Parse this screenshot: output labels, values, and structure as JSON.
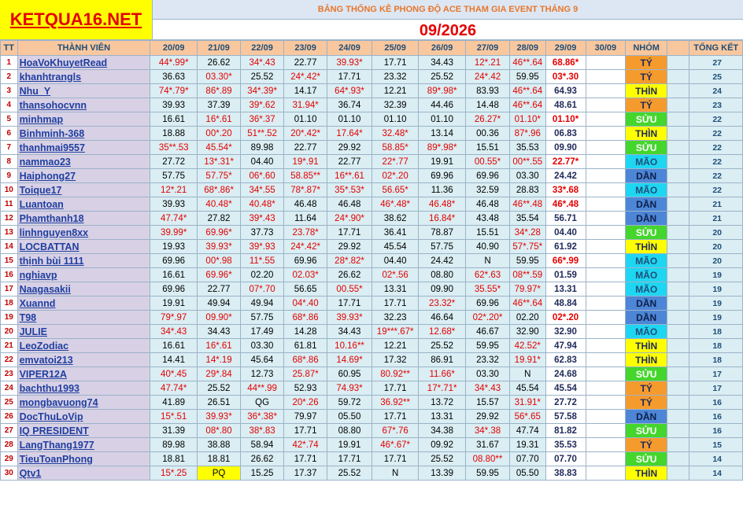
{
  "logo": "KETQUA16.NET",
  "title": "BẢNG THỐNG KÊ PHONG ĐỘ ACE THAM GIA EVENT THÁNG 9",
  "month": "09/2026",
  "headers": {
    "tt": "TT",
    "member": "THÀNH VIÊN",
    "dates": [
      "20/09",
      "21/09",
      "22/09",
      "23/09",
      "24/09",
      "25/09",
      "26/09",
      "27/09",
      "28/09",
      "29/09",
      "30/09"
    ],
    "group": "NHÓM",
    "total": "TỔNG KẾT"
  },
  "colors": {
    "TÝ": "#f59b2d",
    "THÌN": "#ffff00",
    "SỬU": "#44d62c",
    "MÃO": "#1fd6f2",
    "DẦN": "#4d86d6"
  },
  "rows": [
    {
      "tt": "1",
      "name": "HoaVoKhuyetRead",
      "vals": [
        "44*.99*",
        "26.62",
        "34*.43",
        "22.77",
        "39.93*",
        "17.71",
        "34.43",
        "12*.21",
        "46**.64",
        "68.86*",
        ""
      ],
      "group": "TÝ",
      "total": "27"
    },
    {
      "tt": "2",
      "name": "khanhtrangls",
      "vals": [
        "36.63",
        "03.30*",
        "25.52",
        "24*.42*",
        "17.71",
        "23.32",
        "25.52",
        "24*.42",
        "59.95",
        "03*.30",
        ""
      ],
      "group": "TÝ",
      "total": "25"
    },
    {
      "tt": "3",
      "name": "Nhu_Y",
      "vals": [
        "74*.79*",
        "86*.89",
        "34*.39*",
        "14.17",
        "64*.93*",
        "12.21",
        "89*.98*",
        "83.93",
        "46**.64",
        "64.93",
        ""
      ],
      "group": "THÌN",
      "total": "24"
    },
    {
      "tt": "4",
      "name": "thansohocvnn",
      "vals": [
        "39.93",
        "37.39",
        "39*.62",
        "31.94*",
        "36.74",
        "32.39",
        "44.46",
        "14.48",
        "46**.64",
        "48.61",
        ""
      ],
      "group": "TÝ",
      "total": "23"
    },
    {
      "tt": "5",
      "name": "minhmap",
      "vals": [
        "16.61",
        "16*.61",
        "36*.37",
        "01.10",
        "01.10",
        "01.10",
        "01.10",
        "26.27*",
        "01.10*",
        "01.10*",
        ""
      ],
      "group": "SỬU",
      "total": "22"
    },
    {
      "tt": "6",
      "name": "Binhminh-368",
      "vals": [
        "18.88",
        "00*.20",
        "51**.52",
        "20*.42*",
        "17.64*",
        "32.48*",
        "13.14",
        "00.36",
        "87*.96",
        "06.83",
        ""
      ],
      "group": "THÌN",
      "total": "22"
    },
    {
      "tt": "7",
      "name": "thanhmai9557",
      "vals": [
        "35**.53",
        "45.54*",
        "89.98",
        "22.77",
        "29.92",
        "58.85*",
        "89*.98*",
        "15.51",
        "35.53",
        "09.90",
        ""
      ],
      "group": "SỬU",
      "total": "22"
    },
    {
      "tt": "8",
      "name": "nammao23",
      "vals": [
        "27.72",
        "13*.31*",
        "04.40",
        "19*.91",
        "22.77",
        "22*.77",
        "19.91",
        "00.55*",
        "00**.55",
        "22.77*",
        ""
      ],
      "group": "MÃO",
      "total": "22"
    },
    {
      "tt": "9",
      "name": "Haiphong27",
      "vals": [
        "57.75",
        "57.75*",
        "06*.60",
        "58.85**",
        "16**.61",
        "02*.20",
        "69.96",
        "69.96",
        "03.30",
        "24.42",
        ""
      ],
      "group": "DẦN",
      "total": "22"
    },
    {
      "tt": "10",
      "name": "Toique17",
      "vals": [
        "12*.21",
        "68*.86*",
        "34*.55",
        "78*.87*",
        "35*.53*",
        "56.65*",
        "11.36",
        "32.59",
        "28.83",
        "33*.68",
        ""
      ],
      "group": "MÃO",
      "total": "22"
    },
    {
      "tt": "11",
      "name": "Luantoan",
      "vals": [
        "39.93",
        "40.48*",
        "40.48*",
        "46.48",
        "46.48",
        "46*.48*",
        "46.48*",
        "46.48",
        "46**.48",
        "46*.48",
        ""
      ],
      "group": "DẦN",
      "total": "21"
    },
    {
      "tt": "12",
      "name": "Phamthanh18",
      "vals": [
        "47.74*",
        "27.82",
        "39*.43",
        "11.64",
        "24*.90*",
        "38.62",
        "16.84*",
        "43.48",
        "35.54",
        "56.71",
        ""
      ],
      "group": "DẦN",
      "total": "21"
    },
    {
      "tt": "13",
      "name": "linhnguyen8xx",
      "vals": [
        "39.99*",
        "69.96*",
        "37.73",
        "23.78*",
        "17.71",
        "36.41",
        "78.87",
        "15.51",
        "34*.28",
        "04.40",
        ""
      ],
      "group": "SỬU",
      "total": "20"
    },
    {
      "tt": "14",
      "name": "LOCBATTAN",
      "vals": [
        "19.93",
        "39.93*",
        "39*.93",
        "24*.42*",
        "29.92",
        "45.54",
        "57.75",
        "40.90",
        "57*.75*",
        "61.92",
        ""
      ],
      "group": "THÌN",
      "total": "20"
    },
    {
      "tt": "15",
      "name": "thịnh bùi 1111",
      "vals": [
        "69.96",
        "00*.98",
        "11*.55",
        "69.96",
        "28*.82*",
        "04.40",
        "24.42",
        "N",
        "59.95",
        "66*.99",
        ""
      ],
      "group": "MÃO",
      "total": "20"
    },
    {
      "tt": "16",
      "name": "nghiavp",
      "vals": [
        "16.61",
        "69.96*",
        "02.20",
        "02.03*",
        "26.62",
        "02*.56",
        "08.80",
        "62*.63",
        "08**.59",
        "01.59",
        ""
      ],
      "group": "MÃO",
      "total": "19"
    },
    {
      "tt": "17",
      "name": "Naagasakii",
      "vals": [
        "69.96",
        "22.77",
        "07*.70",
        "56.65",
        "00.55*",
        "13.31",
        "09.90",
        "35.55*",
        "79.97*",
        "13.31",
        ""
      ],
      "group": "MÃO",
      "total": "19"
    },
    {
      "tt": "18",
      "name": "Xuannd",
      "vals": [
        "19.91",
        "49.94",
        "49.94",
        "04*.40",
        "17.71",
        "17.71",
        "23.32*",
        "69.96",
        "46**.64",
        "48.84",
        ""
      ],
      "group": "DẦN",
      "total": "19"
    },
    {
      "tt": "19",
      "name": "T98",
      "vals": [
        "79*.97",
        "09.90*",
        "57.75",
        "68*.86",
        "39.93*",
        "32.23",
        "46.64",
        "02*.20*",
        "02.20",
        "02*.20",
        ""
      ],
      "group": "DẦN",
      "total": "19"
    },
    {
      "tt": "20",
      "name": "JULIE",
      "vals": [
        "34*.43",
        "34.43",
        "17.49",
        "14.28",
        "34.43",
        "19***.67*",
        "12.68*",
        "46.67",
        "32.90",
        "32.90",
        ""
      ],
      "group": "MÃO",
      "total": "18"
    },
    {
      "tt": "21",
      "name": "LeoZodiac",
      "vals": [
        "16.61",
        "16*.61",
        "03.30",
        "61.81",
        "10.16**",
        "12.21",
        "25.52",
        "59.95",
        "42.52*",
        "47.94",
        ""
      ],
      "group": "THÌN",
      "total": "18"
    },
    {
      "tt": "22",
      "name": "emvatoi213",
      "vals": [
        "14.41",
        "14*.19",
        "45.64",
        "68*.86",
        "14.69*",
        "17.32",
        "86.91",
        "23.32",
        "19.91*",
        "62.83",
        ""
      ],
      "group": "THÌN",
      "total": "18"
    },
    {
      "tt": "23",
      "name": "VIPER12A",
      "vals": [
        "40*.45",
        "29*.84",
        "12.73",
        "25.87*",
        "60.95",
        "80.92**",
        "11.66*",
        "03.30",
        "N",
        "24.68",
        ""
      ],
      "group": "SỬU",
      "total": "17"
    },
    {
      "tt": "24",
      "name": "bachthu1993",
      "vals": [
        "47.74*",
        "25.52",
        "44**.99",
        "52.93",
        "74.93*",
        "17.71",
        "17*.71*",
        "34*.43",
        "45.54",
        "45.54",
        ""
      ],
      "group": "TÝ",
      "total": "17"
    },
    {
      "tt": "25",
      "name": "mongbavuong74",
      "vals": [
        "41.89",
        "26.51",
        "QG",
        "20*.26",
        "59.72",
        "36.92**",
        "13.72",
        "15.57",
        "31.91*",
        "27.72",
        ""
      ],
      "group": "TÝ",
      "total": "16"
    },
    {
      "tt": "26",
      "name": "DocThuLoVip",
      "vals": [
        "15*.51",
        "39.93*",
        "36*.38*",
        "79.97",
        "05.50",
        "17.71",
        "13.31",
        "29.92",
        "56*.65",
        "57.58",
        ""
      ],
      "group": "DẦN",
      "total": "16"
    },
    {
      "tt": "27",
      "name": "IQ PRESIDENT",
      "vals": [
        "31.39",
        "08*.80",
        "38*.83",
        "17.71",
        "08.80",
        "67*.76",
        "34.38",
        "34*.38",
        "47.74",
        "81.82",
        ""
      ],
      "group": "SỬU",
      "total": "16"
    },
    {
      "tt": "28",
      "name": "LangThang1977",
      "vals": [
        "89.98",
        "38.88",
        "58.94",
        "42*.74",
        "19.91",
        "46*.67*",
        "09.92",
        "31.67",
        "19.31",
        "35.53",
        ""
      ],
      "group": "TÝ",
      "total": "15"
    },
    {
      "tt": "29",
      "name": "TieuToanPhong",
      "vals": [
        "18.81",
        "18.81",
        "26.62",
        "17.71",
        "17.71",
        "17.71",
        "25.52",
        "08.80**",
        "07.70",
        "07.70",
        ""
      ],
      "group": "SỬU",
      "total": "14"
    },
    {
      "tt": "30",
      "name": "Qtv1",
      "vals": [
        "15*.25",
        "PQ",
        "15.25",
        "17.37",
        "25.52",
        "N",
        "13.39",
        "59.95",
        "05.50",
        "38.83",
        ""
      ],
      "group": "THÌN",
      "total": "14"
    }
  ]
}
